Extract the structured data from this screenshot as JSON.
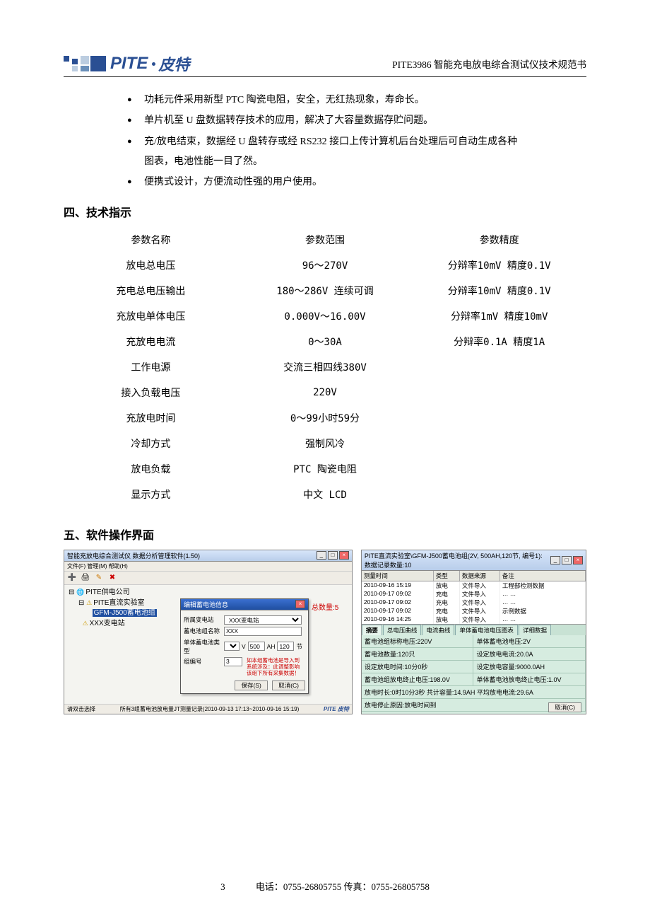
{
  "header": {
    "brand_en": "PITE",
    "brand_cn": "皮特",
    "doc_title": "PITE3986 智能充电放电综合测试仪技术规范书"
  },
  "bullets": [
    "功耗元件采用新型 PTC 陶瓷电阻，安全，无红热现象，寿命长。",
    "单片机至 U 盘数据转存技术的应用，解决了大容量数据存贮问题。",
    "充/放电结束，数据经 U 盘转存或经 RS232 接口上传计算机后台处理后可自动生成各种图表，电池性能一目了然。",
    "便携式设计，方便流动性强的用户使用。"
  ],
  "sec4_title": "四、技术指示",
  "spec": {
    "head": [
      "参数名称",
      "参数范围",
      "参数精度"
    ],
    "rows": [
      [
        "放电总电压",
        "96～270V",
        "分辩率10mV 精度0.1V"
      ],
      [
        "充电总电压输出",
        "180～286V 连续可调",
        "分辩率10mV 精度0.1V"
      ],
      [
        "充放电单体电压",
        "0.000V～16.00V",
        "分辩率1mV 精度10mV"
      ],
      [
        "充放电电流",
        "0～30A",
        "分辩率0.1A 精度1A"
      ],
      [
        "工作电源",
        "交流三相四线380V",
        ""
      ],
      [
        "接入负载电压",
        "220V",
        ""
      ],
      [
        "充放电时间",
        "0～99小时59分",
        ""
      ],
      [
        "冷却方式",
        "强制风冷",
        ""
      ],
      [
        "放电负载",
        "PTC 陶瓷电阻",
        ""
      ],
      [
        "显示方式",
        "中文 LCD",
        ""
      ]
    ]
  },
  "sec5_title": "五、软件操作界面",
  "shotA": {
    "title": "智能充放电综合测试仪 数据分析管理软件(1.50)",
    "menubar": "文件(F) 管理(M) 帮助(H)",
    "count_label": "总数量:5",
    "tree_root": "PITE供电公司",
    "tree_lab": "PITE直流实验室",
    "tree_group": "GFM-J500蓄电池组",
    "tree_station": "XXX变电站",
    "dialog_title": "编辑蓄电池信息",
    "f_station": "所属变电站",
    "v_station": "XXX变电站",
    "f_groupname": "蓄电池组名称",
    "v_groupname": "XXX",
    "f_celltype": "单体蓄电池类型",
    "v_celltype_v": "2",
    "v_celltype_ah": "500",
    "v_celltype_cnt": "120",
    "unit_v": "V",
    "unit_ah": "AH",
    "unit_cnt": "节",
    "f_groupno": "组编号",
    "v_groupno": "3",
    "note": "如本组蓄电池是导入到系统涉及：此调整影响该组下所有采集数据！",
    "btn_save": "保存(S)",
    "btn_cancel": "取消(C)",
    "status_left": "请双击选择",
    "status_mid": "所有3组蓄电池放电量JT测量记录(2010-09-13 17:13~2010-09-16 15:19)",
    "status_right": "PITE 皮特"
  },
  "shotB": {
    "title": "PITE直流实验室\\GFM-J500蓄电池组(2V, 500AH,120节, 编号1): 数据记录数量:10",
    "cols": [
      "测量时间",
      "类型",
      "数据来源",
      "备注"
    ],
    "rows": [
      [
        "2010-09-16 15:19",
        "放电",
        "文件导入",
        "工程部检测数据"
      ],
      [
        "2010-09-17 09:02",
        "充电",
        "文件导入",
        "… …"
      ],
      [
        "2010-09-17 09:02",
        "充电",
        "文件导入",
        "… …"
      ],
      [
        "2010-09-17 09:02",
        "充电",
        "文件导入",
        "示例数据"
      ],
      [
        "2010-09-16 14:25",
        "放电",
        "文件导入",
        "… …"
      ]
    ],
    "tabs": [
      "摘要",
      "总电压曲线",
      "电流曲线",
      "单体蓄电池电压图表",
      "详细数据"
    ],
    "info": [
      [
        "蓄电池组标称电压:220V",
        "单体蓄电池电压:2V"
      ],
      [
        "蓄电池数量:120只",
        "设定放电电流:20.0A"
      ],
      [
        "设定放电时间:10分0秒",
        "设定放电容量:9000.0AH"
      ],
      [
        "蓄电池组放电终止电压:198.0V",
        "单体蓄电池放电终止电压:1.0V"
      ],
      [
        "放电时长:0时10分3秒 共计容量:14.9AH   平均放电电流:29.6A",
        ""
      ],
      [
        "放电停止原因:放电时间到",
        ""
      ]
    ],
    "btn_cancel": "取消(C)"
  },
  "footer": {
    "page": "3",
    "contact": "电话：0755-26805755   传真：0755-26805758"
  }
}
